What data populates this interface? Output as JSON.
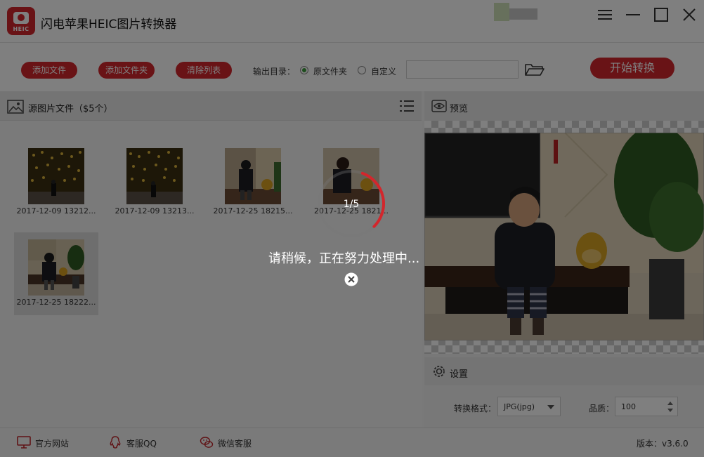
{
  "app": {
    "title": "闪电苹果HEIC图片转换器",
    "logo_text": "HEIC"
  },
  "toolbar": {
    "add_file": "添加文件",
    "add_folder": "添加文件夹",
    "clear_list": "清除列表",
    "output_label": "输出目录：",
    "output_options": [
      {
        "label": "原文件夹",
        "selected": true
      },
      {
        "label": "自定义",
        "selected": false
      }
    ],
    "output_path": "",
    "start": "开始转换"
  },
  "file_panel": {
    "title": "源图片文件（$5个）",
    "files": [
      {
        "name": "2017-12-09 13212...",
        "scene": "night-lights",
        "selected": false
      },
      {
        "name": "2017-12-09 13213...",
        "scene": "night-lights",
        "selected": false
      },
      {
        "name": "2017-12-25 18215...",
        "scene": "indoor-boy",
        "selected": false
      },
      {
        "name": "2017-12-25 1821...",
        "scene": "indoor-boy-close",
        "selected": false
      },
      {
        "name": "2017-12-25 18222...",
        "scene": "indoor-boy-plant",
        "selected": true
      }
    ]
  },
  "preview": {
    "title": "预览"
  },
  "settings": {
    "title": "设置",
    "format_label": "转换格式：",
    "format_value": "JPG(jpg)",
    "quality_label": "品质：",
    "quality_value": "100"
  },
  "footer": {
    "website": "官方网站",
    "qq": "客服QQ",
    "wechat": "微信客服",
    "version": "版本：v3.6.0"
  },
  "modal": {
    "progress": "1/5",
    "progress_fraction": 0.2,
    "message": "请稍候，正在努力处理中..."
  },
  "colors": {
    "accent": "#d3262c",
    "overlay": "rgba(0,0,0,0.5)"
  },
  "icons": [
    "camera-logo-icon",
    "minimize-icon",
    "maximize-icon",
    "close-icon",
    "folder-open-icon",
    "image-icon",
    "list-icon",
    "eye-icon",
    "gear-icon",
    "monitor-icon",
    "qq-icon",
    "wechat-icon",
    "spinner-icon",
    "cancel-icon"
  ]
}
